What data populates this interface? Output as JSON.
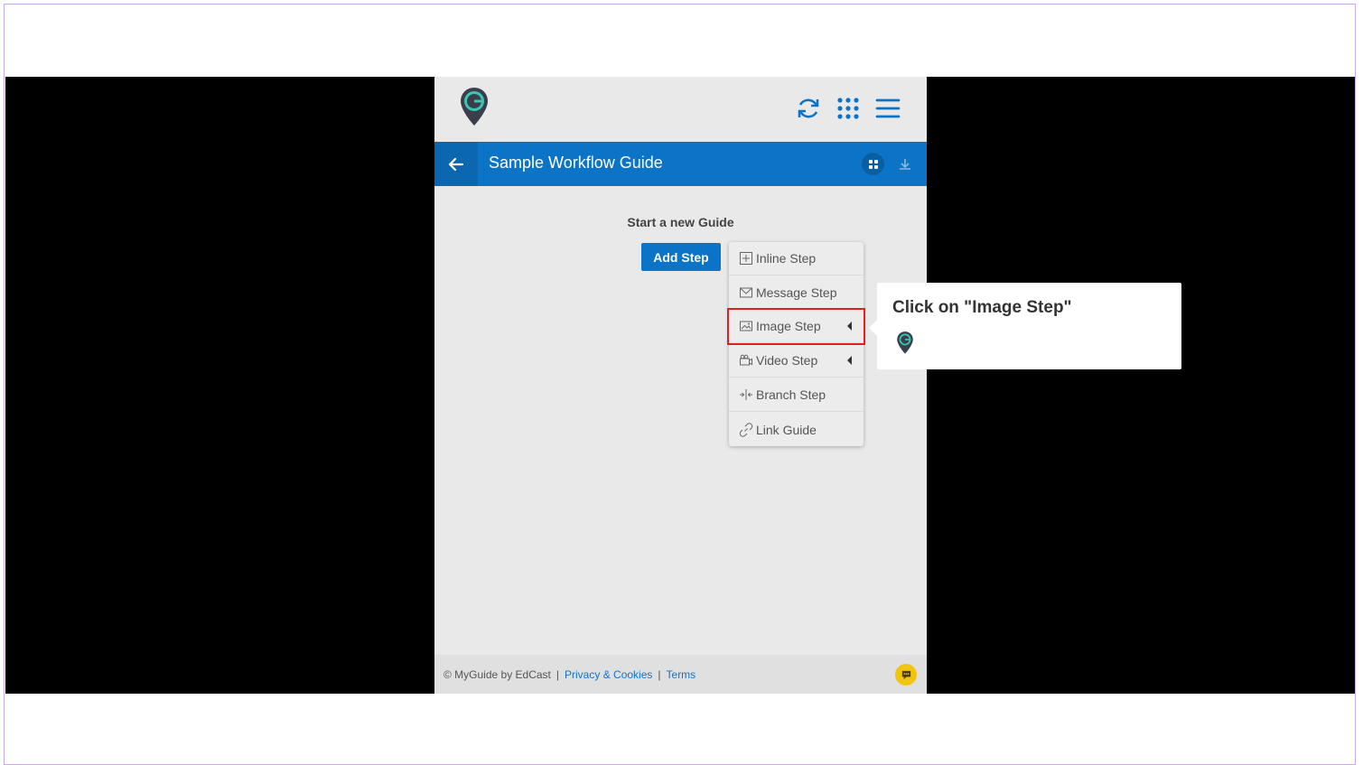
{
  "header": {
    "title": "Sample Workflow Guide"
  },
  "main": {
    "start_text": "Start a new Guide",
    "add_step_label": "Add Step"
  },
  "menu": {
    "items": [
      {
        "label": "Inline Step",
        "icon": "plus-square-icon"
      },
      {
        "label": "Message Step",
        "icon": "envelope-icon"
      },
      {
        "label": "Image Step",
        "icon": "image-icon",
        "submenu": true,
        "highlighted": true
      },
      {
        "label": "Video Step",
        "icon": "video-camera-icon",
        "submenu": true
      },
      {
        "label": "Branch Step",
        "icon": "branch-icon"
      },
      {
        "label": "Link Guide",
        "icon": "link-icon"
      }
    ]
  },
  "tooltip": {
    "text": "Click on \"Image Step\""
  },
  "footer": {
    "copyright": "© MyGuide by EdCast",
    "privacy_label": "Privacy & Cookies",
    "terms_label": "Terms"
  },
  "colors": {
    "accent": "#0c74c6",
    "highlight": "#e02020",
    "chat": "#f1c40f"
  }
}
